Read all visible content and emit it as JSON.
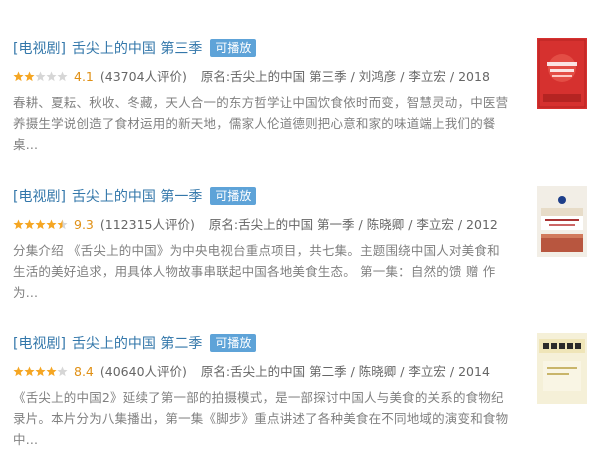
{
  "results": [
    {
      "category": "[电视剧]",
      "title": "舌尖上的中国 第三季",
      "playable_label": "可播放",
      "stars_fraction": 0.4,
      "score": "4.1",
      "votes": "(43704人评价)",
      "origin": "原名:舌尖上的中国 第三季 / 刘鸿彦 / 李立宏 / 2018",
      "description_lines": [
        "春耕、夏耘、秋收、冬藏，天人合一的东方哲学让中国饮食依时而变，智慧灵动，中医营",
        "养摄生学说创造了食材运用的新天地，儒家人伦道德则把心意和家的味道端上我们的餐",
        "桌..."
      ],
      "cover_text": "舌尖上的中国",
      "cover_color": "#d6312f"
    },
    {
      "category": "[电视剧]",
      "title": "舌尖上的中国 第一季",
      "playable_label": "可播放",
      "stars_fraction": 0.9,
      "score": "9.3",
      "votes": "(112315人评价)",
      "origin": "原名:舌尖上的中国 第一季 / 陈晓卿 / 李立宏 / 2012",
      "description_lines": [
        "分集介绍 《舌尖上的中国》为中央电视台重点项目，共七集。主题围绕中国人对美食和",
        "生活的美好追求，用具体人物故事串联起中国各地美食生态。 第一集：自然的馈 赠 作",
        "为..."
      ],
      "cover_text": "A Bite of China",
      "cover_color": "#f2eee6"
    },
    {
      "category": "[电视剧]",
      "title": "舌尖上的中国 第二季",
      "playable_label": "可播放",
      "stars_fraction": 0.8,
      "score": "8.4",
      "votes": "(40640人评价)",
      "origin": "原名:舌尖上的中国 第二季 / 陈晓卿 / 李立宏 / 2014",
      "description_lines": [
        "《舌尖上的中国2》延续了第一部的拍摄模式，是一部探讨中国人与美食的关系的食物纪",
        "录片。本片分为八集播出，第一集《脚步》重点讲述了各种美食在不同地域的演变和食物",
        "中..."
      ],
      "cover_text": "舌尖上的中国",
      "cover_color": "#f5f0d8"
    }
  ],
  "colors": {
    "link": "#3377aa",
    "badge": "#5ea3d8",
    "star": "#f5a623",
    "star_empty": "#d6d6d6",
    "score": "#e09015"
  }
}
